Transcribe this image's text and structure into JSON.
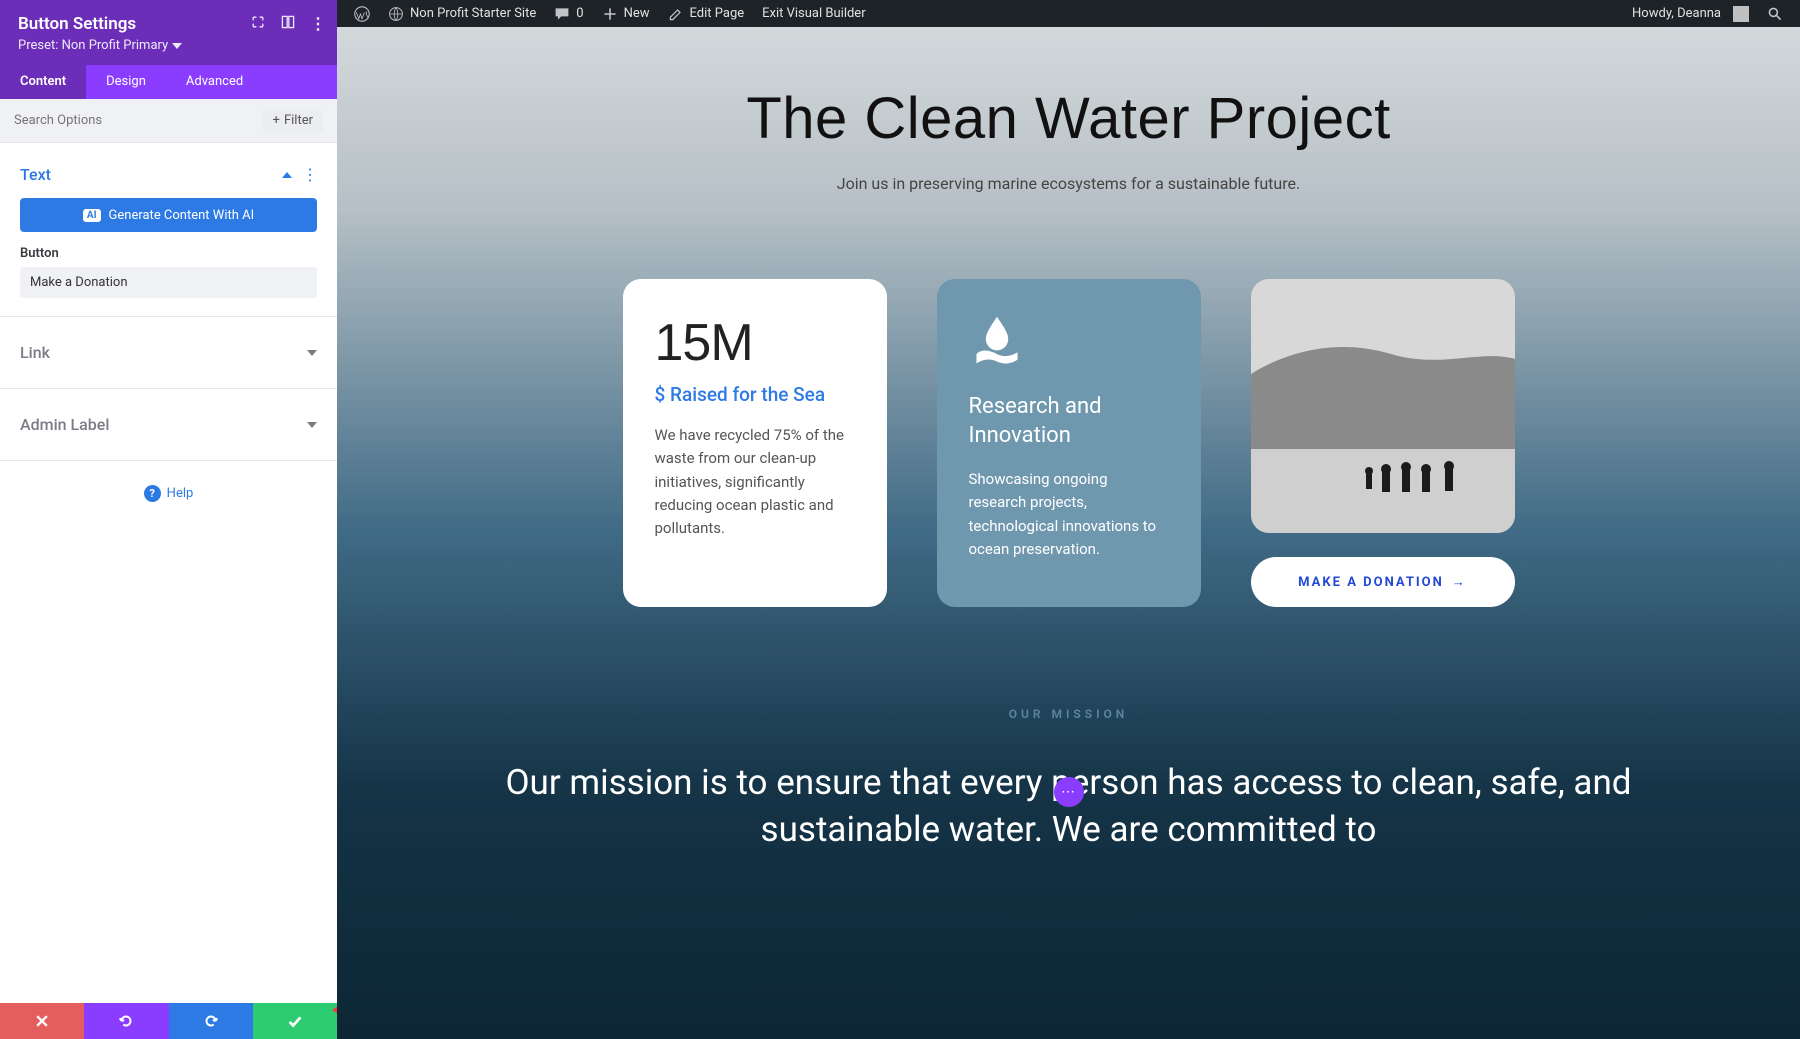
{
  "adminbar": {
    "site_name": "Non Profit Starter Site",
    "comments": "0",
    "new_label": "New",
    "edit_label": "Edit Page",
    "exit_vb": "Exit Visual Builder",
    "howdy": "Howdy, Deanna"
  },
  "sidebar": {
    "title": "Button Settings",
    "preset_label": "Preset: Non Profit Primary",
    "tabs": {
      "content": "Content",
      "design": "Design",
      "advanced": "Advanced"
    },
    "search_placeholder": "Search Options",
    "filter_label": "Filter",
    "sections": {
      "text": "Text",
      "link": "Link",
      "admin_label": "Admin Label"
    },
    "ai_button": "Generate Content With AI",
    "button_field_label": "Button",
    "button_value": "Make a Donation",
    "help": "Help"
  },
  "page": {
    "hero_title": "The Clean Water Project",
    "hero_sub": "Join us in preserving marine ecosystems for a sustainable future.",
    "card1": {
      "big": "15M",
      "head": "$ Raised for the Sea",
      "body": "We have recycled 75% of the waste from our clean-up initiatives, significantly reducing ocean plastic and pollutants."
    },
    "card2": {
      "head": "Research and Innovation",
      "body": "Showcasing ongoing research projects, technological innovations to ocean preservation."
    },
    "donate_label": "MAKE A DONATION",
    "mission_eyebrow": "OUR MISSION",
    "mission_text": "Our mission is to ensure that every person has access to clean, safe, and sustainable water. We are committed to"
  }
}
